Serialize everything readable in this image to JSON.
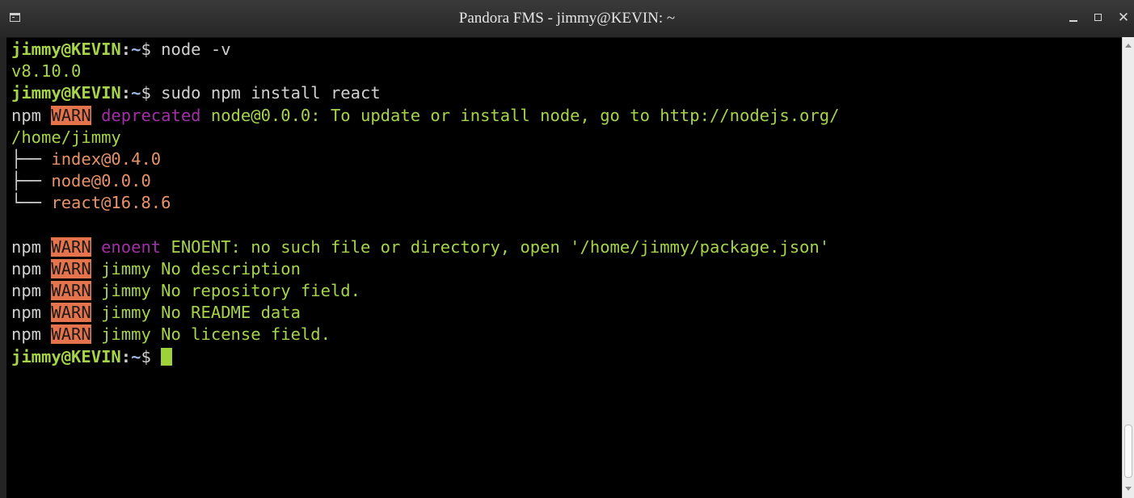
{
  "window": {
    "title": "Pandora FMS - jimmy@KEVIN: ~",
    "icon": "terminal-icon",
    "controls": {
      "minimize": "minimize-icon",
      "maximize": "maximize-icon",
      "close": "✕"
    }
  },
  "terminal": {
    "colors": {
      "prompt_user": "#a6d34a",
      "prompt_path": "#9ab8e6",
      "text": "#a6d34a",
      "warn_bg": "#e5734b",
      "deprecated": "#a22fa8",
      "tree": "#e8926a"
    },
    "prompt": {
      "user_host": "jimmy@KEVIN",
      "separator": ":",
      "path": "~",
      "symbol": "$"
    },
    "lines": [
      {
        "command": " node -v"
      },
      {
        "text": "v8.10.0"
      },
      {
        "command": " sudo npm install react"
      },
      {
        "npm": "npm",
        "warn": "WARN",
        "tag": "deprecated",
        "message": " node@0.0.0: To update or install node, go to http://nodejs.org/"
      },
      {
        "text": "/home/jimmy"
      },
      {
        "tree_prefix": "├── ",
        "package": "index@0.4.0"
      },
      {
        "tree_prefix": "├── ",
        "package": "node@0.0.0"
      },
      {
        "tree_prefix": "└── ",
        "package": "react@16.8.6"
      },
      {
        "text": ""
      },
      {
        "npm": "npm",
        "warn": "WARN",
        "tag": "enoent",
        "message": " ENOENT: no such file or directory, open '/home/jimmy/package.json'"
      },
      {
        "npm": "npm",
        "warn": "WARN",
        "message": " jimmy No description"
      },
      {
        "npm": "npm",
        "warn": "WARN",
        "message": " jimmy No repository field."
      },
      {
        "npm": "npm",
        "warn": "WARN",
        "message": " jimmy No README data"
      },
      {
        "npm": "npm",
        "warn": "WARN",
        "message": " jimmy No license field."
      },
      {
        "command": " "
      }
    ]
  }
}
